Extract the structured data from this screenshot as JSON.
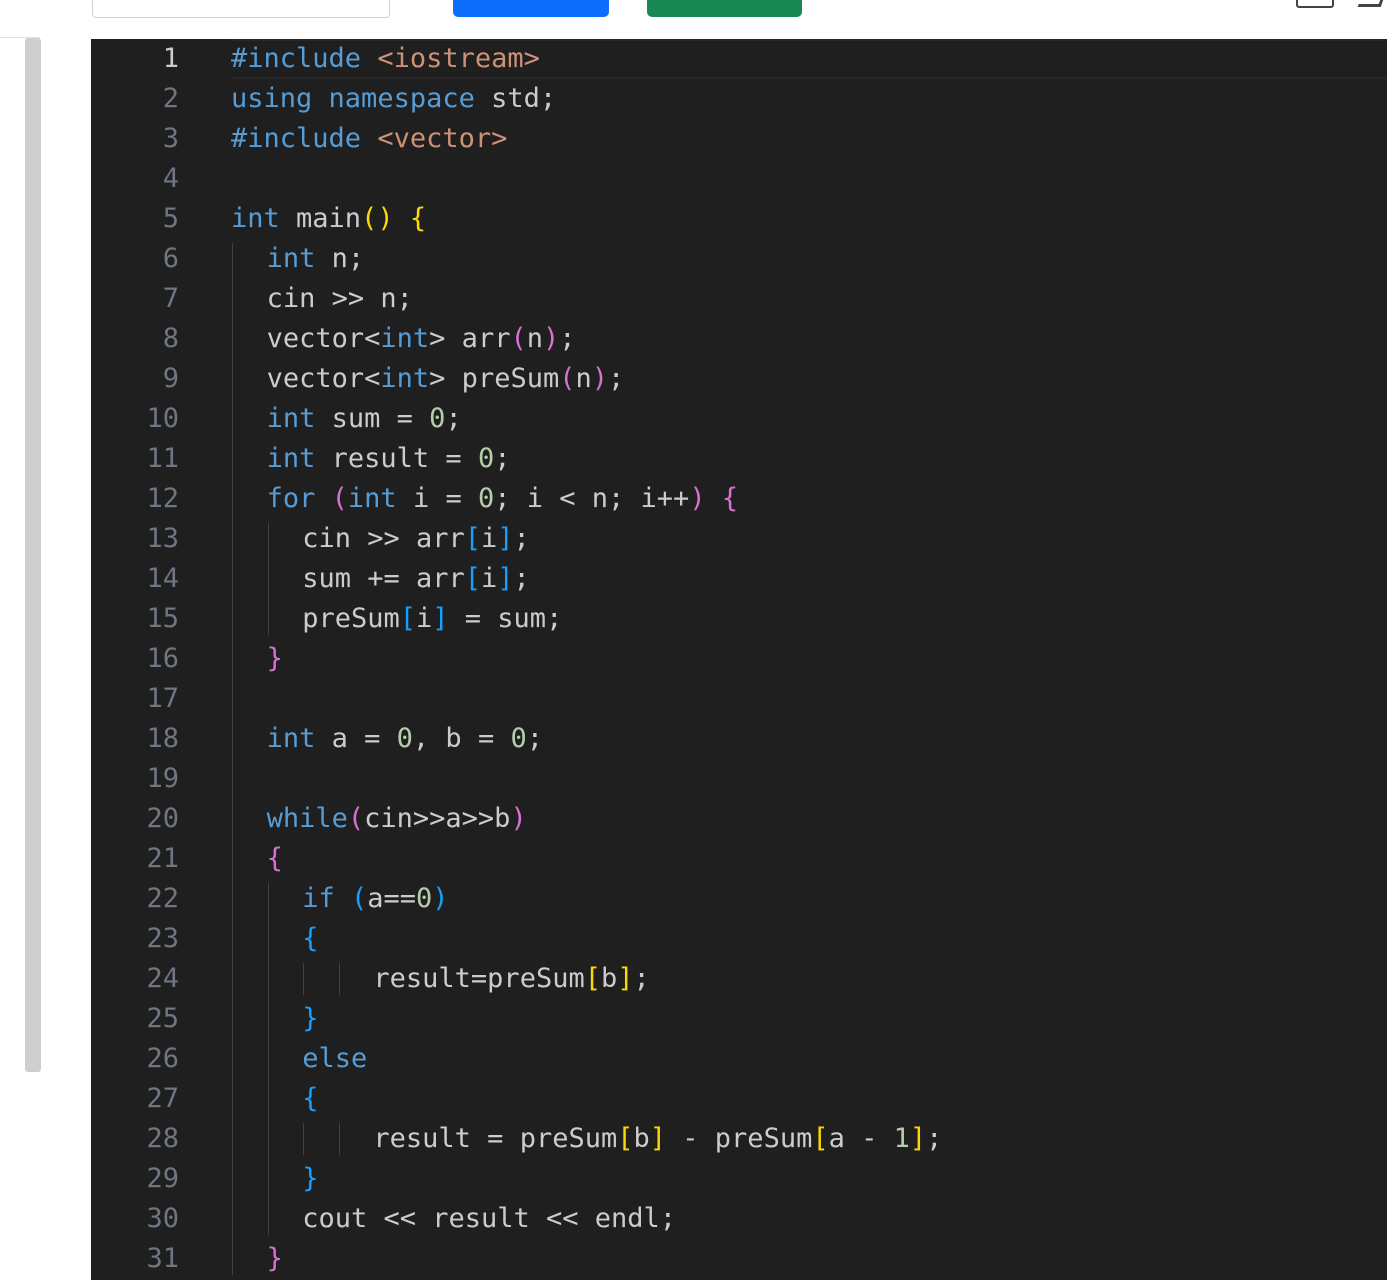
{
  "editor": {
    "language": "cpp",
    "active_line": 1,
    "theme_colors": {
      "background": "#1f1f1f",
      "keyword": "#569cd6",
      "string": "#ce9178",
      "number": "#b5cea8",
      "bracket_level_1": "#ffd700",
      "bracket_level_2": "#da70d6",
      "bracket_level_3": "#179fff"
    },
    "lines": [
      {
        "num": "1",
        "indent": 0,
        "tokens": [
          [
            "kw",
            "#include"
          ],
          [
            "txt",
            " "
          ],
          [
            "str",
            "<iostream>"
          ]
        ]
      },
      {
        "num": "2",
        "indent": 0,
        "tokens": [
          [
            "kw",
            "using"
          ],
          [
            "txt",
            " "
          ],
          [
            "kw",
            "namespace"
          ],
          [
            "txt",
            " std;"
          ]
        ]
      },
      {
        "num": "3",
        "indent": 0,
        "tokens": [
          [
            "kw",
            "#include"
          ],
          [
            "txt",
            " "
          ],
          [
            "str",
            "<vector>"
          ]
        ]
      },
      {
        "num": "4",
        "indent": 0,
        "tokens": []
      },
      {
        "num": "5",
        "indent": 0,
        "tokens": [
          [
            "kw",
            "int"
          ],
          [
            "txt",
            " main"
          ],
          [
            "p1",
            "()"
          ],
          [
            "txt",
            " "
          ],
          [
            "p1",
            "{"
          ]
        ]
      },
      {
        "num": "6",
        "indent": 1,
        "tokens": [
          [
            "kw",
            "int"
          ],
          [
            "txt",
            " n;"
          ]
        ]
      },
      {
        "num": "7",
        "indent": 1,
        "tokens": [
          [
            "txt",
            "cin >> n;"
          ]
        ]
      },
      {
        "num": "8",
        "indent": 1,
        "tokens": [
          [
            "txt",
            "vector<"
          ],
          [
            "kw",
            "int"
          ],
          [
            "txt",
            "> arr"
          ],
          [
            "p2",
            "("
          ],
          [
            "txt",
            "n"
          ],
          [
            "p2",
            ")"
          ],
          [
            "txt",
            ";"
          ]
        ]
      },
      {
        "num": "9",
        "indent": 1,
        "tokens": [
          [
            "txt",
            "vector<"
          ],
          [
            "kw",
            "int"
          ],
          [
            "txt",
            "> preSum"
          ],
          [
            "p2",
            "("
          ],
          [
            "txt",
            "n"
          ],
          [
            "p2",
            ")"
          ],
          [
            "txt",
            ";"
          ]
        ]
      },
      {
        "num": "10",
        "indent": 1,
        "tokens": [
          [
            "kw",
            "int"
          ],
          [
            "txt",
            " sum = "
          ],
          [
            "num",
            "0"
          ],
          [
            "txt",
            ";"
          ]
        ]
      },
      {
        "num": "11",
        "indent": 1,
        "tokens": [
          [
            "kw",
            "int"
          ],
          [
            "txt",
            " result = "
          ],
          [
            "num",
            "0"
          ],
          [
            "txt",
            ";"
          ]
        ]
      },
      {
        "num": "12",
        "indent": 1,
        "tokens": [
          [
            "kw",
            "for"
          ],
          [
            "txt",
            " "
          ],
          [
            "p2",
            "("
          ],
          [
            "kw",
            "int"
          ],
          [
            "txt",
            " i = "
          ],
          [
            "num",
            "0"
          ],
          [
            "txt",
            "; i < n; i++"
          ],
          [
            "p2",
            ")"
          ],
          [
            "txt",
            " "
          ],
          [
            "p2",
            "{"
          ]
        ]
      },
      {
        "num": "13",
        "indent": 2,
        "tokens": [
          [
            "txt",
            "cin >> arr"
          ],
          [
            "p3",
            "["
          ],
          [
            "txt",
            "i"
          ],
          [
            "p3",
            "]"
          ],
          [
            "txt",
            ";"
          ]
        ]
      },
      {
        "num": "14",
        "indent": 2,
        "tokens": [
          [
            "txt",
            "sum += arr"
          ],
          [
            "p3",
            "["
          ],
          [
            "txt",
            "i"
          ],
          [
            "p3",
            "]"
          ],
          [
            "txt",
            ";"
          ]
        ]
      },
      {
        "num": "15",
        "indent": 2,
        "tokens": [
          [
            "txt",
            "preSum"
          ],
          [
            "p3",
            "["
          ],
          [
            "txt",
            "i"
          ],
          [
            "p3",
            "]"
          ],
          [
            "txt",
            " = sum;"
          ]
        ]
      },
      {
        "num": "16",
        "indent": 1,
        "tokens": [
          [
            "p2",
            "}"
          ]
        ]
      },
      {
        "num": "17",
        "indent": 0,
        "tokens": []
      },
      {
        "num": "18",
        "indent": 1,
        "tokens": [
          [
            "kw",
            "int"
          ],
          [
            "txt",
            " a = "
          ],
          [
            "num",
            "0"
          ],
          [
            "txt",
            ", b = "
          ],
          [
            "num",
            "0"
          ],
          [
            "txt",
            ";"
          ]
        ]
      },
      {
        "num": "19",
        "indent": 0,
        "tokens": []
      },
      {
        "num": "20",
        "indent": 1,
        "tokens": [
          [
            "kw",
            "while"
          ],
          [
            "p2",
            "("
          ],
          [
            "txt",
            "cin>>a>>b"
          ],
          [
            "p2",
            ")"
          ]
        ]
      },
      {
        "num": "21",
        "indent": 1,
        "tokens": [
          [
            "p2",
            "{"
          ]
        ]
      },
      {
        "num": "22",
        "indent": 2,
        "tokens": [
          [
            "kw",
            "if"
          ],
          [
            "txt",
            " "
          ],
          [
            "p3",
            "("
          ],
          [
            "txt",
            "a=="
          ],
          [
            "num",
            "0"
          ],
          [
            "p3",
            ")"
          ]
        ]
      },
      {
        "num": "23",
        "indent": 2,
        "tokens": [
          [
            "p3",
            "{"
          ]
        ]
      },
      {
        "num": "24",
        "indent": 4,
        "tokens": [
          [
            "txt",
            "result=preSum"
          ],
          [
            "p1",
            "["
          ],
          [
            "txt",
            "b"
          ],
          [
            "p1",
            "]"
          ],
          [
            "txt",
            ";"
          ]
        ]
      },
      {
        "num": "25",
        "indent": 2,
        "tokens": [
          [
            "p3",
            "}"
          ]
        ]
      },
      {
        "num": "26",
        "indent": 2,
        "tokens": [
          [
            "kw",
            "else"
          ]
        ]
      },
      {
        "num": "27",
        "indent": 2,
        "tokens": [
          [
            "p3",
            "{"
          ]
        ]
      },
      {
        "num": "28",
        "indent": 4,
        "tokens": [
          [
            "txt",
            "result = preSum"
          ],
          [
            "p1",
            "["
          ],
          [
            "txt",
            "b"
          ],
          [
            "p1",
            "]"
          ],
          [
            "txt",
            " - preSum"
          ],
          [
            "p1",
            "["
          ],
          [
            "txt",
            "a - "
          ],
          [
            "num",
            "1"
          ],
          [
            "p1",
            "]"
          ],
          [
            "txt",
            ";"
          ]
        ]
      },
      {
        "num": "29",
        "indent": 2,
        "tokens": [
          [
            "p3",
            "}"
          ]
        ]
      },
      {
        "num": "30",
        "indent": 2,
        "tokens": [
          [
            "txt",
            "cout << result << endl;"
          ]
        ]
      },
      {
        "num": "31",
        "indent": 1,
        "tokens": [
          [
            "p2",
            "}"
          ]
        ]
      }
    ]
  }
}
